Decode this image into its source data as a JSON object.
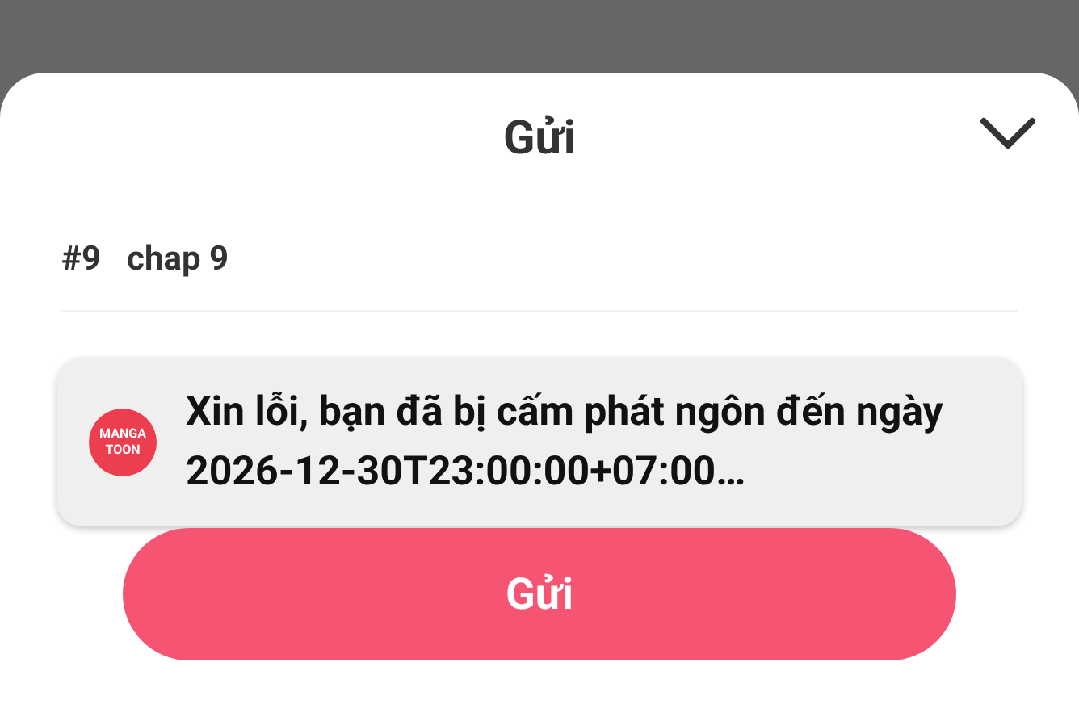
{
  "sheet": {
    "title": "Gửi"
  },
  "chapter": {
    "number": "#9",
    "name": "chap 9"
  },
  "toast": {
    "logo": [
      "MANGA",
      "TOON"
    ],
    "message": "Xin lỗi, bạn đã bị cấm phát ngôn đến ngày 2026-12-30T23:00:00+07:00…"
  },
  "submit_button": "Gửi"
}
